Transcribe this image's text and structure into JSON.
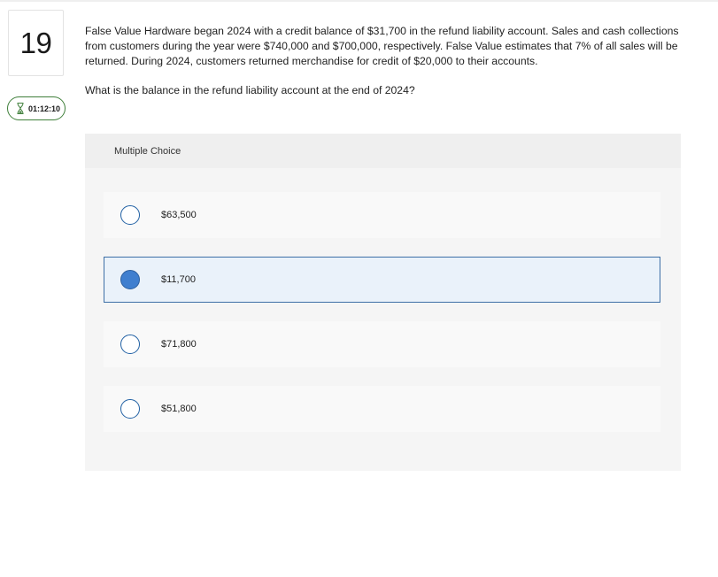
{
  "question": {
    "number": "19",
    "timer": "01:12:10",
    "text": "False Value Hardware began 2024 with a credit balance of $31,700 in the refund liability account. Sales and cash collections from customers during the year were $740,000 and $700,000, respectively. False Value estimates that 7% of all sales will be returned. During 2024, customers returned merchandise for credit of $20,000 to their accounts.",
    "prompt": "What is the balance in the refund liability account at the end of 2024?"
  },
  "multiple_choice": {
    "header": "Multiple Choice",
    "selected_value": "$11,700",
    "options": [
      {
        "label": "$63,500",
        "selected": false
      },
      {
        "label": "$11,700",
        "selected": true
      },
      {
        "label": "$71,800",
        "selected": false
      },
      {
        "label": "$51,800",
        "selected": false
      }
    ]
  },
  "icons": {
    "timer": "hourglass-icon"
  },
  "colors": {
    "accent": "#3f7fcf",
    "timer_border": "#3f7f3a",
    "selected_bg": "#eaf2fa"
  }
}
